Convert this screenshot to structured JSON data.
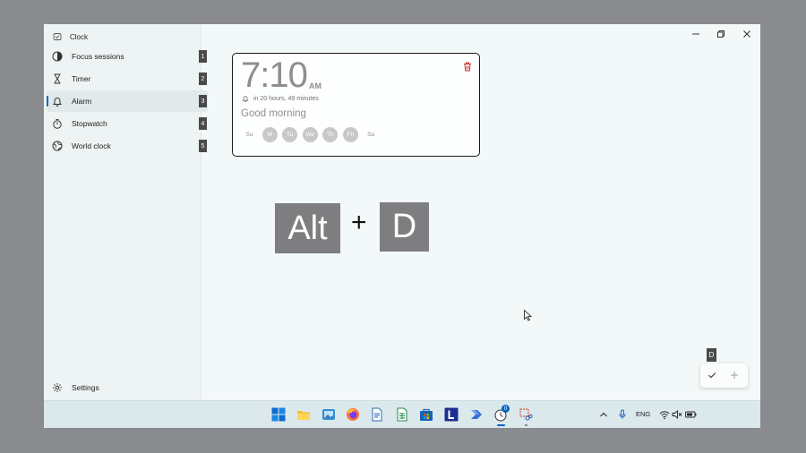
{
  "app": {
    "title": "Clock"
  },
  "nav": {
    "items": [
      {
        "label": "Focus sessions",
        "badge": "1",
        "icon": "focus-icon"
      },
      {
        "label": "Timer",
        "badge": "2",
        "icon": "hourglass-icon"
      },
      {
        "label": "Alarm",
        "badge": "3",
        "icon": "bell-icon",
        "active": true
      },
      {
        "label": "Stopwatch",
        "badge": "4",
        "icon": "stopwatch-icon"
      },
      {
        "label": "World clock",
        "badge": "5",
        "icon": "globe-icon"
      }
    ],
    "settings_label": "Settings"
  },
  "alarm": {
    "time": "7:10",
    "ampm": "AM",
    "remaining": "in 20 hours, 49 minutes",
    "name": "Good morning",
    "days": [
      {
        "label": "Su",
        "on": false
      },
      {
        "label": "M",
        "on": true
      },
      {
        "label": "Tu",
        "on": true
      },
      {
        "label": "We",
        "on": true
      },
      {
        "label": "Th",
        "on": true
      },
      {
        "label": "Fri",
        "on": true
      },
      {
        "label": "Sa",
        "on": false
      }
    ]
  },
  "shortcut": {
    "key1": "Alt",
    "plus": "+",
    "key2": "D"
  },
  "key_tip": "D",
  "taskbar": {
    "language": "ENG",
    "clock_badge": "0"
  },
  "colors": {
    "accent": "#0067c0",
    "delete": "#c42b1c",
    "key_bg": "#7e7e81"
  }
}
